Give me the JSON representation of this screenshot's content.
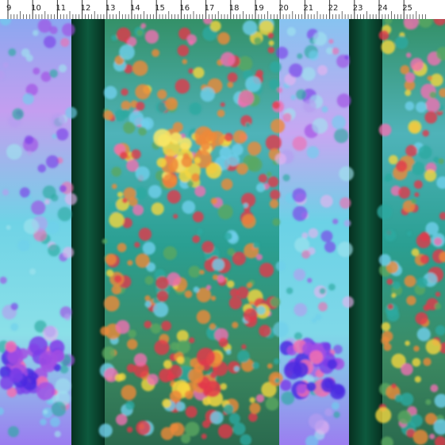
{
  "ruler": {
    "numbers": [
      "9",
      "10",
      "11",
      "12",
      "13",
      "14",
      "15",
      "16",
      "17",
      "18",
      "19",
      "20",
      "21",
      "22",
      "23",
      "24",
      "25"
    ]
  },
  "palette": {
    "dark_band": "#0a4a34",
    "dark_band_shadow": "#06321f",
    "lavender": "#b59cf0",
    "sky": "#6fd0ec",
    "teal": "#2aa9a0",
    "green": "#5aa860",
    "red": "#e23a4b",
    "orange": "#ee8a3a",
    "yellow": "#f4d640",
    "pink": "#f06fb1",
    "purple": "#7b3ee8",
    "violet": "#a24de3"
  },
  "description_icons": {
    "ruler": "measuring-ruler",
    "art": "floral-fabric-pattern"
  }
}
